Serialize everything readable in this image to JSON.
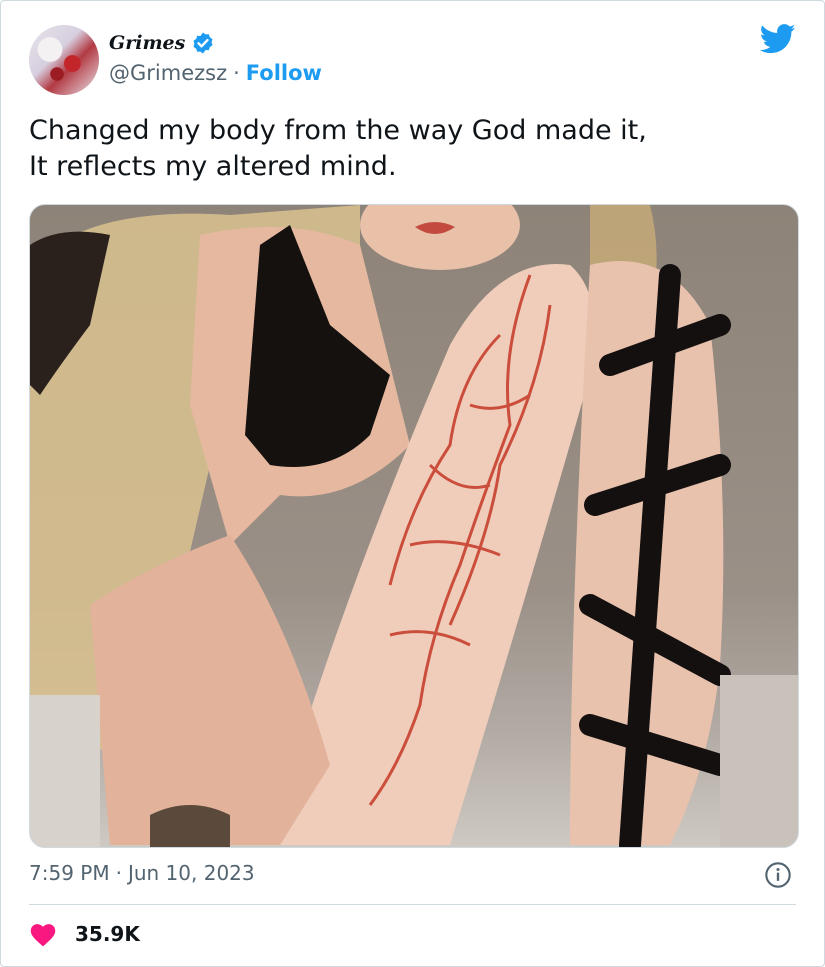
{
  "author": {
    "display_name": "Grimes",
    "handle": "@Grimezsz",
    "follow_label": "Follow",
    "separator": "·",
    "verified": true,
    "avatar_icon": "avatar-image"
  },
  "tweet": {
    "text_lines": [
      "Changed my body from the way God made it,",
      "It reflects my altered mind."
    ],
    "media_icon": "photo"
  },
  "meta": {
    "time": "7:59 PM",
    "separator": "·",
    "date": "Jun 10, 2023"
  },
  "stats": {
    "likes": "35.9K"
  },
  "colors": {
    "twitter_blue": "#1d9bf0",
    "like_pink": "#f91880",
    "text": "#0f1419",
    "muted": "#536471",
    "border": "#cfd9de"
  }
}
